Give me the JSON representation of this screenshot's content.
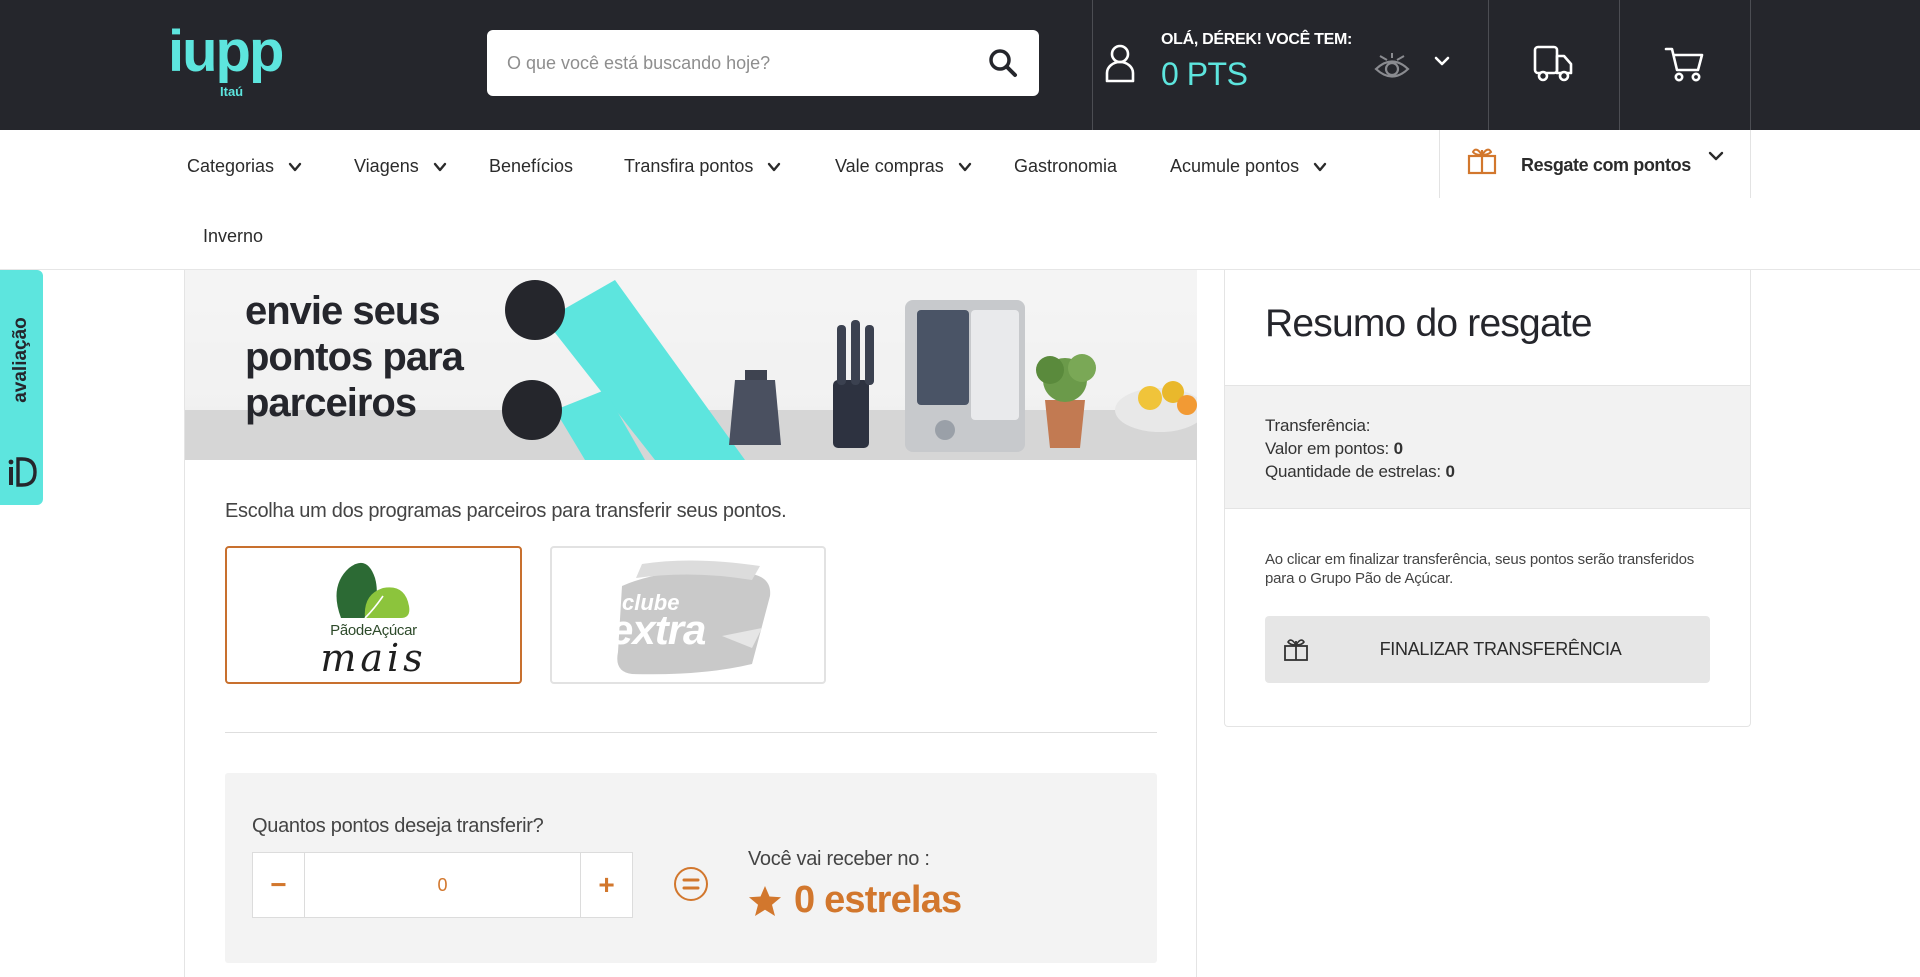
{
  "header": {
    "logo_main": "iupp",
    "logo_sub": "Itaú",
    "search_placeholder": "O que você está buscando hoje?",
    "search_value": "",
    "greeting": "OLÁ, DÉREK! VOCÊ TEM:",
    "points": "0 PTS"
  },
  "nav": {
    "categorias": "Categorias",
    "viagens": "Viagens",
    "beneficios": "Benefícios",
    "transfira": "Transfira pontos",
    "vale_compras": "Vale compras",
    "gastronomia": "Gastronomia",
    "acumule": "Acumule pontos",
    "inverno": "Inverno",
    "resgate": "Resgate com pontos"
  },
  "feedback": {
    "label": "avaliação"
  },
  "banner": {
    "line1": "envie seus",
    "line2": "pontos para",
    "line3": "parceiros"
  },
  "main": {
    "choose_text": "Escolha um dos programas parceiros para transferir seus pontos.",
    "partners": [
      {
        "brand": "PãodeAçúcar",
        "tagline": "mais",
        "selected": true
      },
      {
        "brand_top": "clube",
        "brand_main": "extra",
        "selected": false
      }
    ],
    "question": "Quantos pontos deseja transferir?",
    "minus": "−",
    "plus": "+",
    "points_value": "0",
    "receive_label": "Você vai receber no :",
    "receive_value": "0 estrelas"
  },
  "summary": {
    "title": "Resumo do resgate",
    "transfer_label": "Transferência:",
    "points_label": "Valor em pontos:",
    "points_value": "0",
    "stars_label": "Quantidade de estrelas:",
    "stars_value": "0",
    "note": "Ao clicar em finalizar transferência, seus pontos serão transferidos para o Grupo Pão de Açúcar.",
    "button": "FINALIZAR TRANSFERÊNCIA"
  },
  "colors": {
    "header_bg": "#25262c",
    "accent_teal": "#5de5de",
    "accent_orange": "#d2772d",
    "selected_border": "#c8702e"
  },
  "icons": [
    "search-icon",
    "user-icon",
    "eye-icon",
    "chevron-down-icon",
    "truck-icon",
    "cart-icon",
    "gift-icon",
    "star-icon",
    "equals-icon"
  ]
}
